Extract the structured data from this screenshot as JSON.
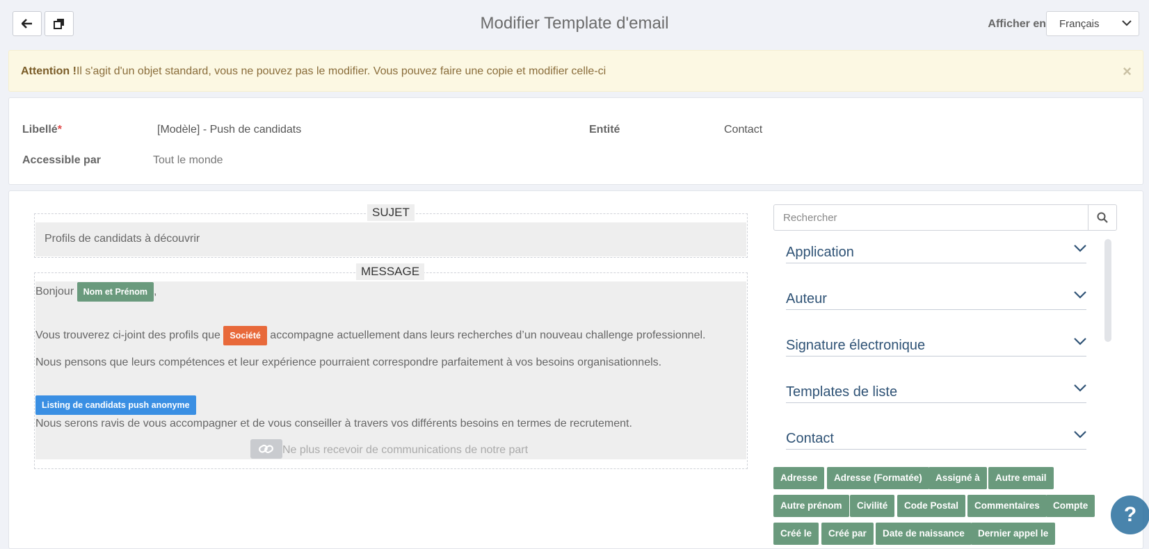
{
  "header": {
    "title": "Modifier Template d'email",
    "lang_label": "Afficher en",
    "lang_value": "Français"
  },
  "alert": {
    "strong": "Attention !",
    "text": "Il s'agit d'un objet standard, vous ne pouvez pas le modifier. Vous pouvez faire une copie et modifier celle-ci",
    "close": "×"
  },
  "info": {
    "libelle_label": "Libellé",
    "required_mark": "*",
    "libelle_value": "[Modèle] - Push de candidats",
    "entite_label": "Entité",
    "entite_value": "Contact",
    "access_label": "Accessible par",
    "access_value": "Tout le monde"
  },
  "subject": {
    "legend": "SUJET",
    "value": "Profils de candidats à découvrir"
  },
  "message": {
    "legend": "MESSAGE",
    "greeting": "Bonjour",
    "tag_name": "Nom et Prénom",
    "comma": ",",
    "line2_pre": "Vous trouverez ci-joint des profils que",
    "tag_company": "Société",
    "line2_post": "accompagne actuellement dans leurs recherches d’un nouveau challenge professionnel.",
    "line3": "Nous pensons que leurs compétences et leur expérience pourraient correspondre parfaitement à vos besoins organisationnels.",
    "tag_listing": "Listing de candidats push anonyme",
    "line4": "Nous serons ravis de vous accompagner et de vous conseiller à travers vos différents besoins en termes de recrutement.",
    "unsubscribe": "Ne plus recevoir de communications de notre part"
  },
  "search": {
    "placeholder": "Rechercher"
  },
  "accordion": [
    {
      "label": "Application"
    },
    {
      "label": "Auteur"
    },
    {
      "label": "Signature électronique"
    },
    {
      "label": "Templates de liste"
    },
    {
      "label": "Contact"
    }
  ],
  "variables": [
    "Adresse",
    "Adresse (Formatée)",
    "Assigné à",
    "Autre email",
    "Autre prénom",
    "Civilité",
    "Code Postal",
    "Commentaires",
    "Compte",
    "Créé le",
    "Créé par",
    "Date de naissance",
    "Dernier appel le"
  ],
  "help": {
    "label": "?"
  },
  "colors": {
    "tag_green": "#6a9a7d",
    "tag_orange": "#e8693a",
    "tag_blue": "#3a8fe3",
    "alert_bg": "#fcf8e3"
  }
}
